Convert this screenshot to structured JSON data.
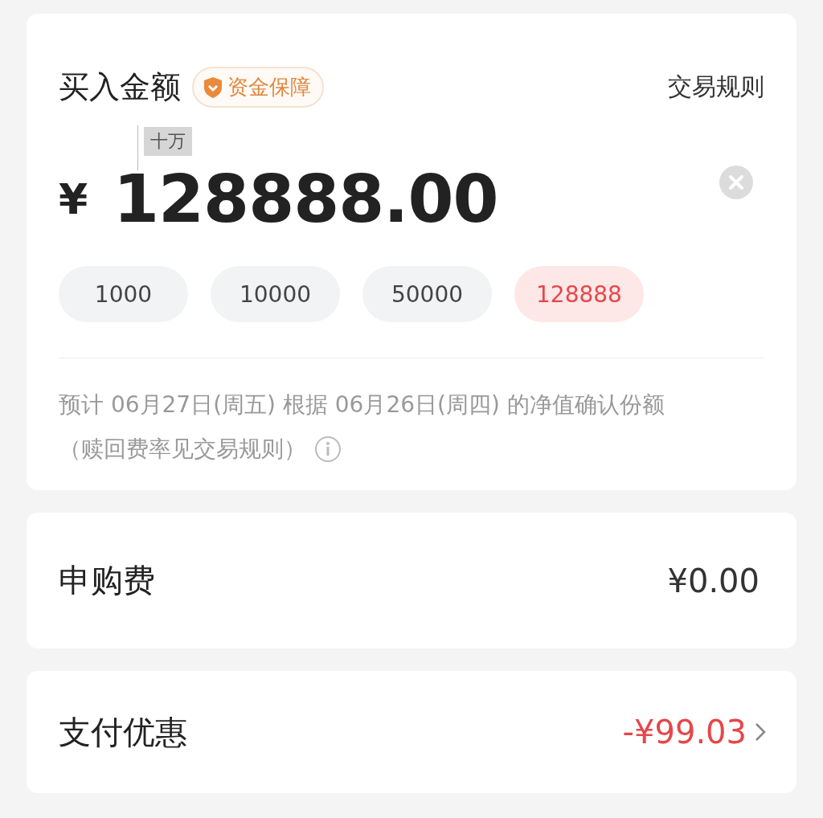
{
  "header": {
    "title": "买入金额",
    "badge": "资金保障",
    "rules_link": "交易规则"
  },
  "amount": {
    "currency": "¥",
    "value": "128888.00",
    "unit_hint": "十万"
  },
  "presets": [
    {
      "label": "1000",
      "selected": false
    },
    {
      "label": "10000",
      "selected": false
    },
    {
      "label": "50000",
      "selected": false
    },
    {
      "label": "128888",
      "selected": true
    }
  ],
  "confirm_note": {
    "text": "预计 06月27日(周五) 根据 06月26日(周四) 的净值确认份额",
    "subnote": "（赎回费率见交易规则）"
  },
  "rows": [
    {
      "kind": "plain",
      "label": "申购费",
      "value": "¥0.00"
    },
    {
      "kind": "discount",
      "label": "支付优惠",
      "value": "-¥99.03"
    }
  ]
}
